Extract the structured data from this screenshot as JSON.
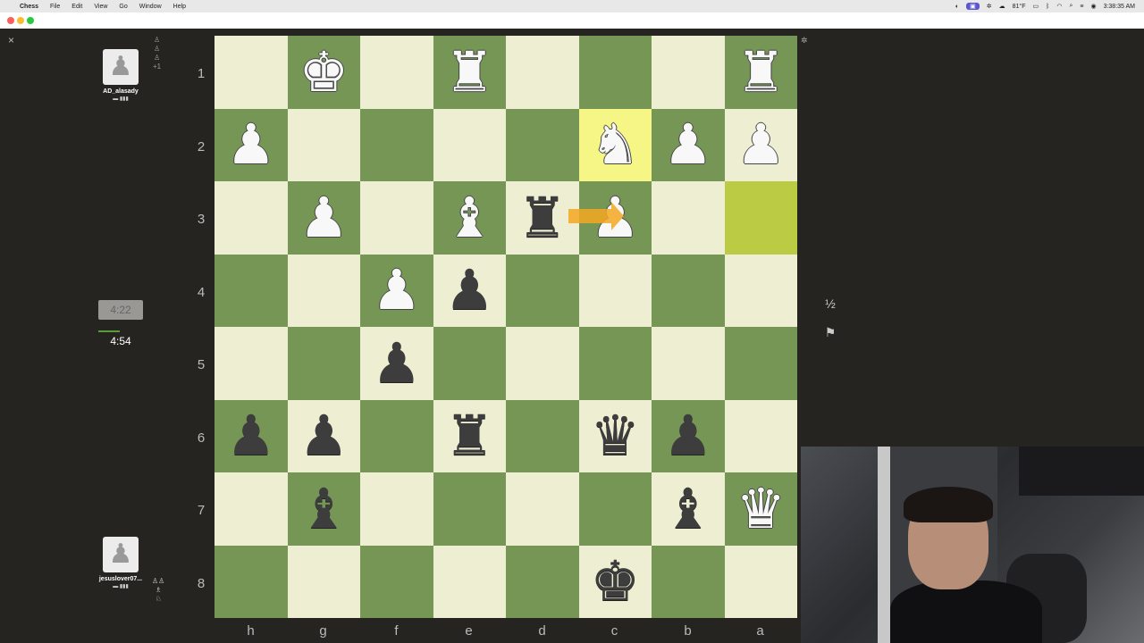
{
  "menubar": {
    "apple": "",
    "items": [
      "Chess",
      "File",
      "Edit",
      "View",
      "Go",
      "Window",
      "Help"
    ],
    "temperature": "81°F",
    "clock": "3:38:35 AM"
  },
  "players": {
    "opponent": {
      "name": "AD_alasady",
      "clock": "4:22"
    },
    "me": {
      "name": "jesuslover07...",
      "clock": "4:54"
    }
  },
  "board": {
    "ranks": [
      "1",
      "2",
      "3",
      "4",
      "5",
      "6",
      "7",
      "8"
    ],
    "files": [
      "h",
      "g",
      "f",
      "e",
      "d",
      "c",
      "b",
      "a"
    ],
    "rows": [
      [
        "",
        "wK",
        "",
        "wR",
        "",
        "",
        "",
        "wR"
      ],
      [
        "wP",
        "",
        "",
        "",
        "",
        "wN",
        "wP",
        "wP"
      ],
      [
        "",
        "wP",
        "",
        "wB",
        "bR",
        "wP",
        "",
        ""
      ],
      [
        "",
        "",
        "wP",
        "bP",
        "",
        "",
        "",
        ""
      ],
      [
        "",
        "",
        "bP",
        "",
        "",
        "",
        "",
        ""
      ],
      [
        "bP",
        "bP",
        "",
        "bR",
        "",
        "bQ",
        "bP",
        ""
      ],
      [
        "",
        "bB",
        "",
        "",
        "",
        "",
        "bB",
        "wQ"
      ],
      [
        "",
        "",
        "",
        "",
        "",
        "bK",
        "",
        ""
      ]
    ],
    "highlight": [
      [
        1,
        5
      ],
      [
        2,
        7
      ]
    ]
  },
  "controls": {
    "draw_label": "½",
    "resign_icon": "flag-icon"
  }
}
